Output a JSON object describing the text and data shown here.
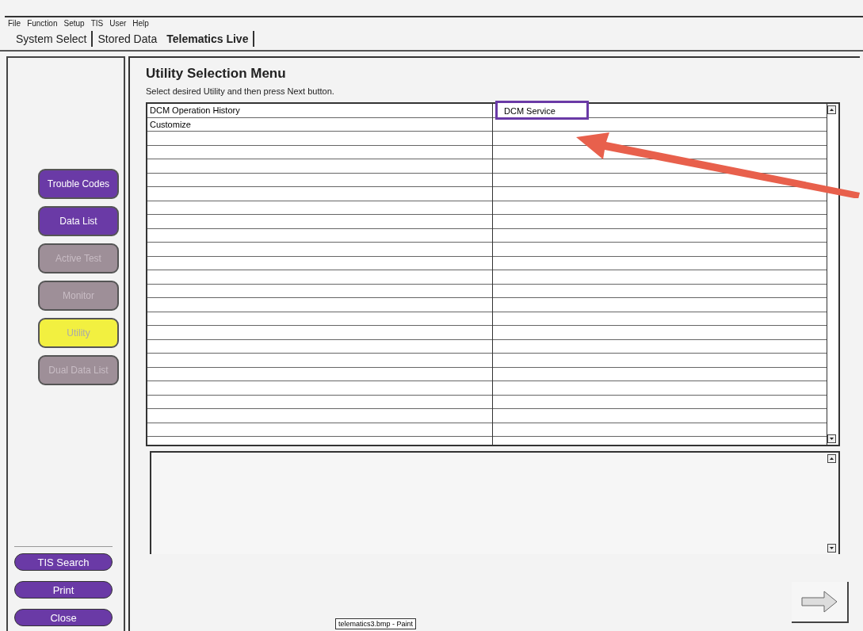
{
  "menu": [
    "File",
    "Function",
    "Setup",
    "TIS",
    "User",
    "Help"
  ],
  "tabs": [
    {
      "label": "System Select",
      "selected": false
    },
    {
      "label": "Stored Data",
      "selected": false
    },
    {
      "label": "Telematics Live",
      "selected": true
    }
  ],
  "sidebar": {
    "items": [
      {
        "label": "Trouble Codes",
        "selected": false,
        "disabled": false
      },
      {
        "label": "Data List",
        "selected": false,
        "disabled": false
      },
      {
        "label": "Active Test",
        "selected": false,
        "disabled": true
      },
      {
        "label": "Monitor",
        "selected": false,
        "disabled": true
      },
      {
        "label": "Utility",
        "selected": true,
        "disabled": false
      },
      {
        "label": "Dual Data List",
        "selected": false,
        "disabled": true
      }
    ],
    "bottom_buttons": [
      "TIS Search",
      "Print",
      "Close"
    ]
  },
  "main": {
    "title": "Utility Selection Menu",
    "instruction": "Select desired Utility and then press Next button.",
    "rows": [
      {
        "cells": [
          {
            "text": "DCM Operation History",
            "highlighted": false
          },
          {
            "text": "DCM Service",
            "highlighted": true
          }
        ]
      },
      {
        "cells": [
          {
            "text": "Customize",
            "highlighted": false
          }
        ]
      }
    ]
  },
  "tooltip": "telematics3.bmp - Paint"
}
